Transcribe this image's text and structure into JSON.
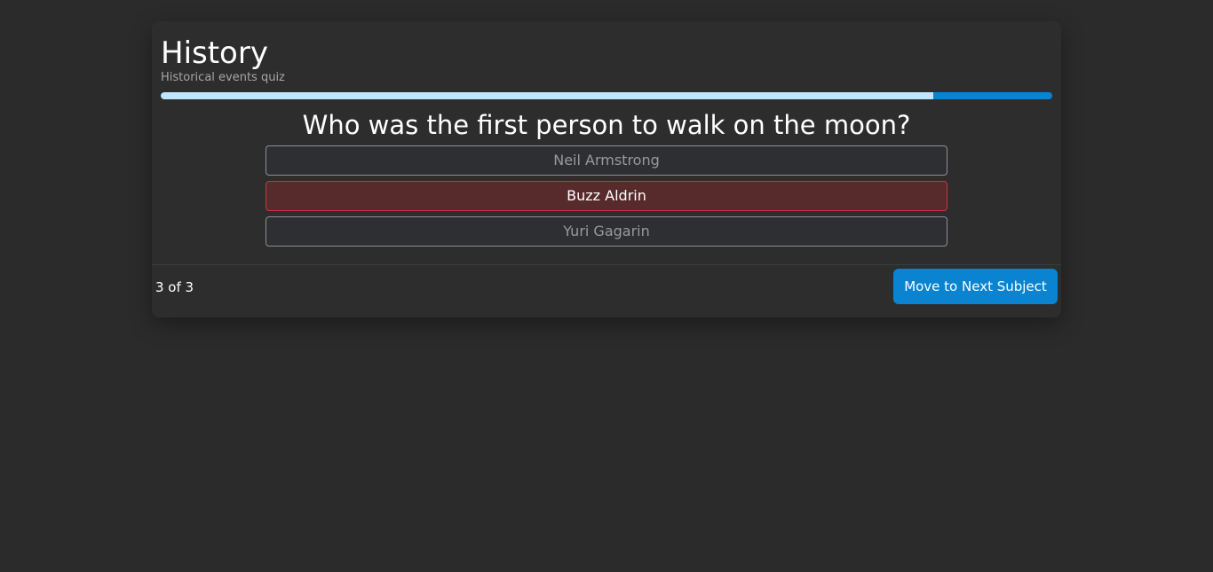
{
  "header": {
    "title": "History",
    "subtitle": "Historical events quiz"
  },
  "progress": {
    "fraction": 0.867
  },
  "question": {
    "text": "Who was the first person to walk on the moon?",
    "answers": [
      {
        "label": "Neil Armstrong",
        "state": "disabled"
      },
      {
        "label": "Buzz Aldrin",
        "state": "selected-wrong"
      },
      {
        "label": "Yuri Gagarin",
        "state": "disabled"
      }
    ]
  },
  "footer": {
    "count": "3 of 3",
    "next_label": "Move to Next Subject"
  },
  "colors": {
    "background": "#2b2b2b",
    "card": "#2d2d2d",
    "accent": "#0a84d0",
    "progress_fill": "#bfe5ff",
    "wrong_bg": "#572a2c",
    "wrong_border": "#c9353f"
  }
}
